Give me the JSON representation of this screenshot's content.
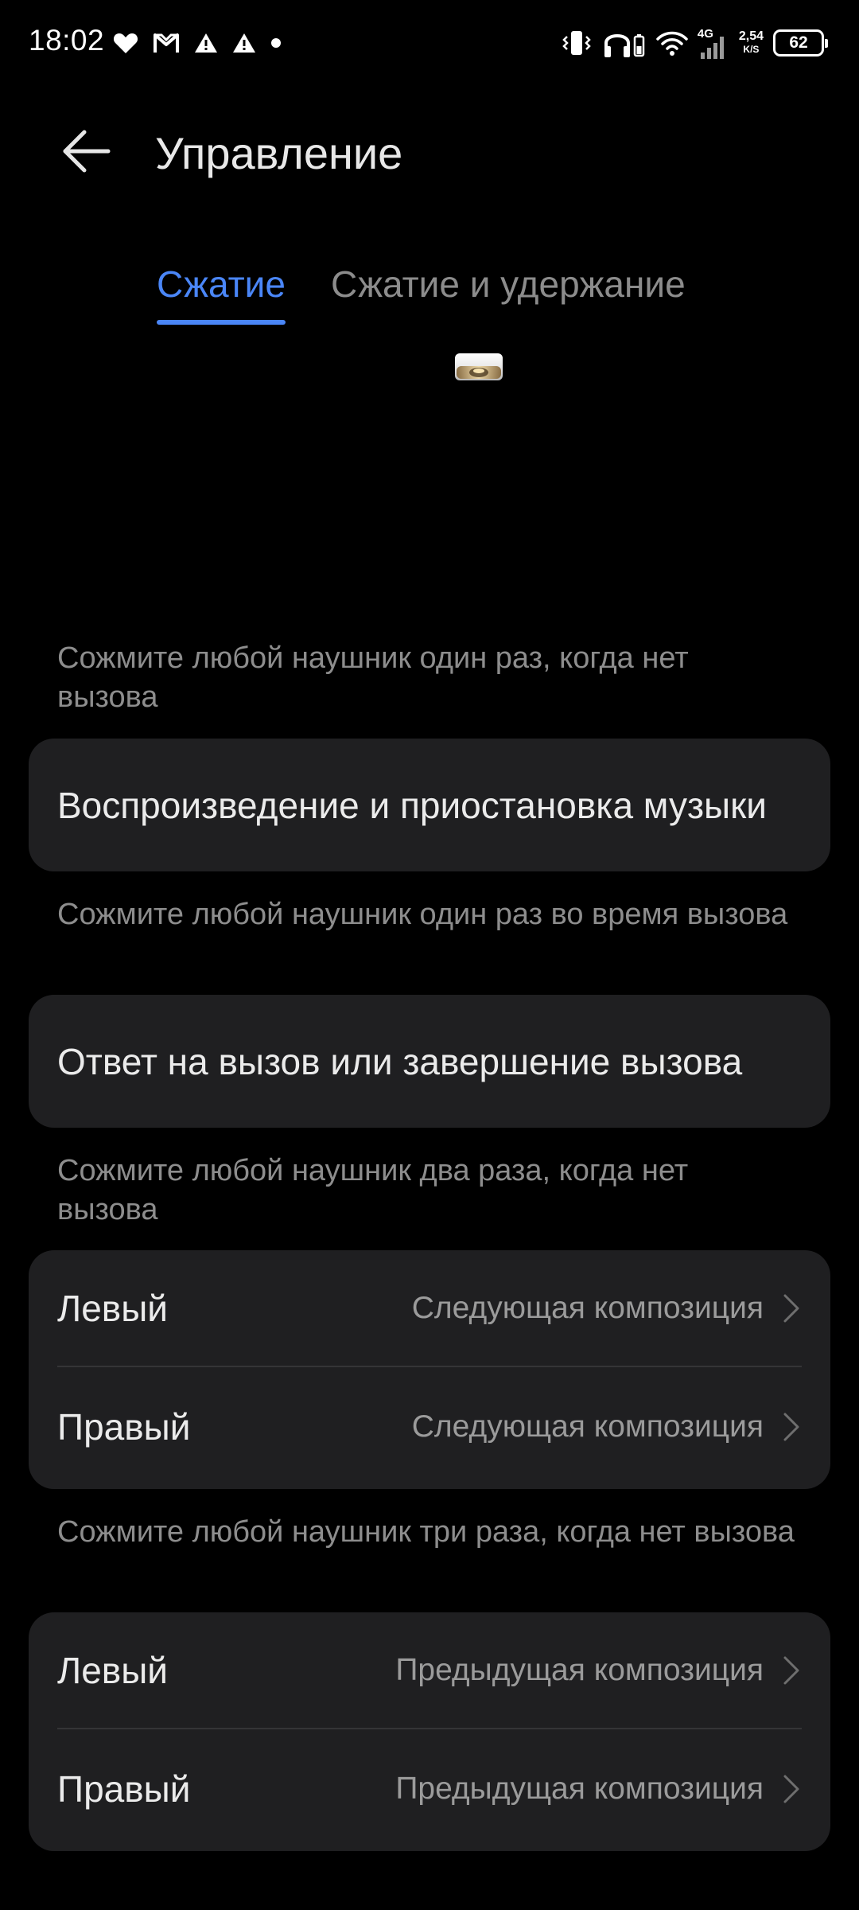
{
  "status_bar": {
    "time": "18:02",
    "network_type": "4G",
    "speed_value": "2,54",
    "speed_unit": "K/S",
    "battery_level": "62",
    "left_icons": [
      "heart-icon",
      "gmail-icon",
      "warning-icon",
      "warning-icon",
      "dot-icon"
    ],
    "right_icons": [
      "vibrate-icon",
      "headphones-icon",
      "wifi-icon",
      "signal-icon",
      "battery-icon"
    ]
  },
  "header": {
    "title": "Управление",
    "back_icon": "arrow-left-icon"
  },
  "tabs": [
    {
      "label": "Сжатие",
      "active": true
    },
    {
      "label": "Сжатие и удержание",
      "active": false
    }
  ],
  "colors": {
    "background": "#000000",
    "card": "#1f1f21",
    "accent": "#4a86f7",
    "primary_text": "#ebebeb",
    "secondary_text": "#8d8d8d",
    "divider": "#343436"
  },
  "sections": [
    {
      "header": "Сожмите любой наушник один раз, когда нет вызова",
      "action": "Воспроизведение и приостановка музыки"
    },
    {
      "header": "Сожмите любой наушник один раз во время вызова",
      "action": "Ответ на вызов или завершение вызова"
    },
    {
      "header": "Сожмите любой наушник два раза, когда нет вызова",
      "rows": [
        {
          "label": "Левый",
          "value": "Следующая композиция"
        },
        {
          "label": "Правый",
          "value": "Следующая композиция"
        }
      ]
    },
    {
      "header": "Сожмите любой наушник три раза, когда нет вызова",
      "rows": [
        {
          "label": "Левый",
          "value": "Предыдущая композиция"
        },
        {
          "label": "Правый",
          "value": "Предыдущая композиция"
        }
      ]
    }
  ]
}
